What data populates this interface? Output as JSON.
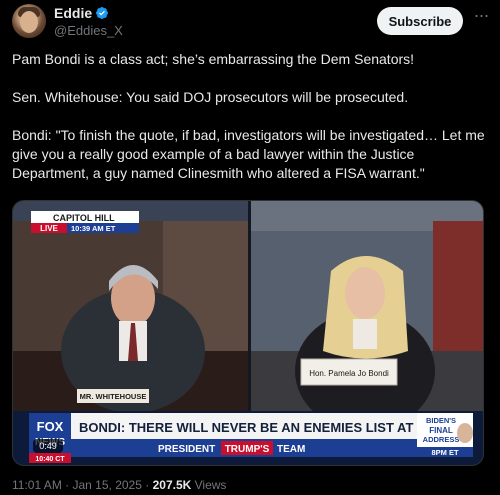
{
  "author": {
    "display_name": "Eddie",
    "handle": "@Eddies_X"
  },
  "actions": {
    "subscribe_label": "Subscribe",
    "more_icon": "more-horizontal-icon"
  },
  "tweet": {
    "paragraphs": [
      "Pam Bondi is a class act; she’s embarrassing the Dem Senators!",
      "Sen. Whitehouse: You said DOJ prosecutors will be prosecuted.",
      "Bondi: \"To finish the quote, if bad, investigators will be investigated… Let me give you a really good example of a bad lawyer within the Justice Department, a guy named Clinesmith who altered a FISA warrant.\""
    ]
  },
  "video": {
    "location_tag": "CAPITOL HILL",
    "live_label": "LIVE",
    "live_time": "10:39 AM ET",
    "left_nameplate": "MR. WHITEHOUSE",
    "right_nameplate": "Hon. Pamela Jo Bondi",
    "headline": "BONDI: THERE WILL NEVER BE AN ENEMIES LIST AT DOJ",
    "subline_prefix": "PRESIDENT",
    "subline_highlight": "TRUMP'S",
    "subline_suffix": "TEAM",
    "network_top": "FOX",
    "network_bottom": "NEWS",
    "time_small": "10:40 CT",
    "promo_line1": "BIDEN'S",
    "promo_line2": "FINAL",
    "promo_line3": "ADDRESS",
    "promo_time": "8PM ET",
    "duration": "0:49",
    "colors": {
      "fox_red": "#c8102e",
      "fox_blue": "#1c3f94",
      "accent_blue": "#1d9bf0"
    }
  },
  "meta": {
    "time": "11:01 AM",
    "separator": "·",
    "date": "Jan 15, 2025",
    "views_count": "207.5K",
    "views_label": "Views"
  }
}
